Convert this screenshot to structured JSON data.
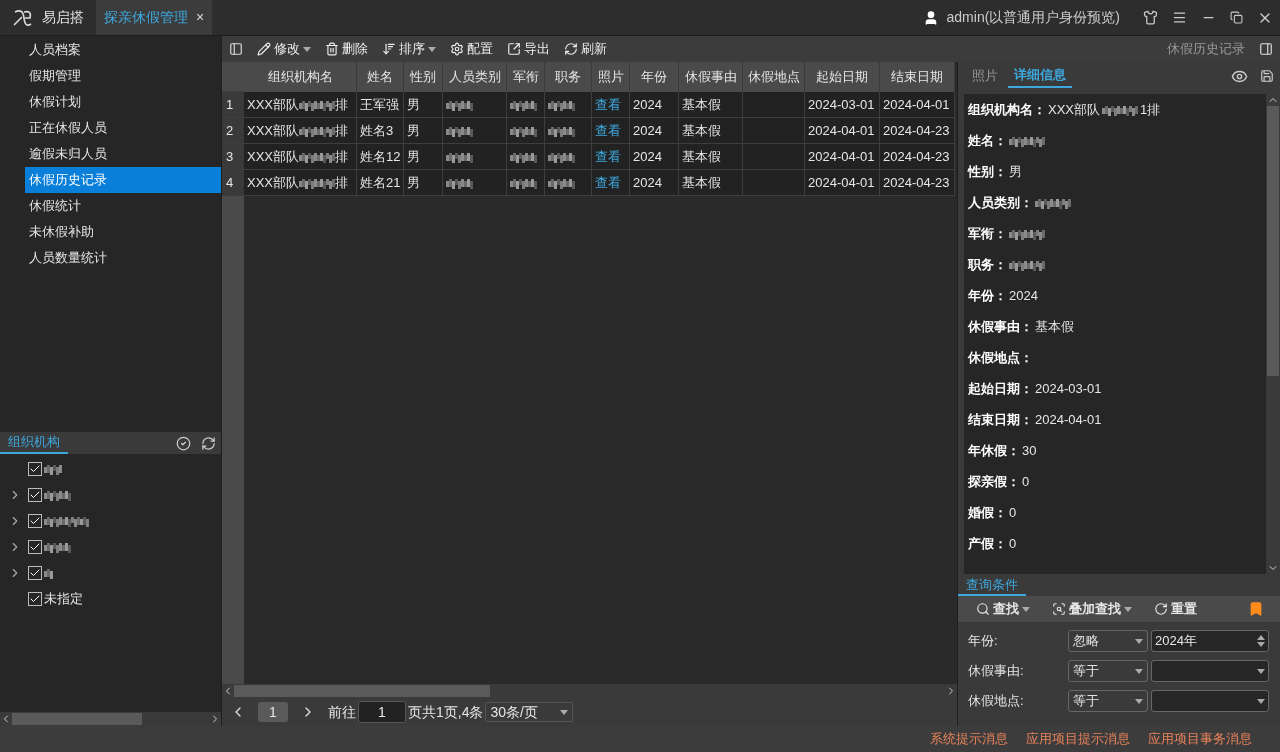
{
  "app": {
    "name": "易启搭"
  },
  "tabs": [
    {
      "label": "探亲休假管理",
      "selected": true,
      "close": "×"
    }
  ],
  "user": {
    "label": "admin(以普通用户身份预览)"
  },
  "nav": [
    {
      "label": "人员档案",
      "selected": false
    },
    {
      "label": "假期管理",
      "selected": false
    },
    {
      "label": "休假计划",
      "selected": false
    },
    {
      "label": "正在休假人员",
      "selected": false
    },
    {
      "label": "逾假未归人员",
      "selected": false
    },
    {
      "label": "休假历史记录",
      "selected": true
    },
    {
      "label": "休假统计",
      "selected": false
    },
    {
      "label": "未休假补助",
      "selected": false
    },
    {
      "label": "人员数量统计",
      "selected": false
    }
  ],
  "org_tree": {
    "title": "组织机构",
    "items": [
      {
        "kind": "leaf",
        "checked": true
      },
      {
        "kind": "branch",
        "checked": true
      },
      {
        "kind": "branch",
        "checked": true
      },
      {
        "kind": "branch",
        "checked": true
      },
      {
        "kind": "branch",
        "checked": true
      },
      {
        "kind": "leaf",
        "checked": true,
        "label": "未指定"
      }
    ]
  },
  "toolbar": [
    {
      "label": "修改",
      "menu": true
    },
    {
      "label": "删除",
      "menu": false
    },
    {
      "label": "排序",
      "menu": true
    },
    {
      "label": "配置",
      "menu": false
    },
    {
      "label": "导出",
      "menu": false
    },
    {
      "label": "刷新",
      "menu": false
    }
  ],
  "breadcrumb": "休假历史记录",
  "table": {
    "columns": [
      "组织机构名",
      "姓名",
      "性别",
      "人员类别",
      "军衔",
      "职务",
      "照片",
      "年份",
      "休假事由",
      "休假地点",
      "起始日期",
      "结束日期"
    ],
    "rows": [
      {
        "number": "1",
        "cells": [
          {
            "kind": "mixed",
            "parts": [
              {
                "text": "XXX部队"
              },
              {
                "kind": "blurred"
              },
              {
                "text": "排"
              }
            ]
          },
          "王军强",
          "男",
          {
            "kind": "blurred"
          },
          {
            "kind": "blurred"
          },
          {
            "kind": "blurred"
          },
          {
            "kind": "link",
            "text": "查看"
          },
          "2024",
          "基本假",
          "",
          "2024-03-01",
          "2024-04-01"
        ]
      },
      {
        "number": "2",
        "cells": [
          {
            "kind": "mixed",
            "parts": [
              {
                "text": "XXX部队"
              },
              {
                "kind": "blurred"
              },
              {
                "text": "排"
              }
            ]
          },
          "姓名3",
          "男",
          {
            "kind": "blurred"
          },
          {
            "kind": "blurred"
          },
          {
            "kind": "blurred"
          },
          {
            "kind": "link",
            "text": "查看"
          },
          "2024",
          "基本假",
          "",
          "2024-04-01",
          "2024-04-23"
        ]
      },
      {
        "number": "3",
        "cells": [
          {
            "kind": "mixed",
            "parts": [
              {
                "text": "XXX部队"
              },
              {
                "kind": "blurred"
              },
              {
                "text": "排"
              }
            ]
          },
          "姓名12",
          "男",
          {
            "kind": "blurred"
          },
          {
            "kind": "blurred"
          },
          {
            "kind": "blurred"
          },
          {
            "kind": "link",
            "text": "查看"
          },
          "2024",
          "基本假",
          "",
          "2024-04-01",
          "2024-04-23"
        ]
      },
      {
        "number": "4",
        "cells": [
          {
            "kind": "mixed",
            "parts": [
              {
                "text": "XXX部队"
              },
              {
                "kind": "blurred"
              },
              {
                "text": "排"
              }
            ]
          },
          "姓名21",
          "男",
          {
            "kind": "blurred"
          },
          {
            "kind": "blurred"
          },
          {
            "kind": "blurred"
          },
          {
            "kind": "link",
            "text": "查看"
          },
          "2024",
          "基本假",
          "",
          "2024-04-01",
          "2024-04-23"
        ]
      }
    ]
  },
  "pagination": {
    "pages": [
      {
        "label": "1",
        "selected": true
      }
    ],
    "goto_label": "前往",
    "goto_value": "1",
    "summary": "页共1页,4条",
    "page_size": "30条/页"
  },
  "detail_tabs": [
    {
      "label": "照片",
      "selected": false
    },
    {
      "label": "详细信息",
      "selected": true
    }
  ],
  "details": [
    {
      "label": "组织机构名：",
      "parts": [
        {
          "text": "XXX部队"
        },
        {
          "kind": "blurred"
        },
        {
          "text": "1排"
        }
      ]
    },
    {
      "label": "姓名：",
      "parts": [
        {
          "kind": "blurred"
        }
      ]
    },
    {
      "label": "性别：",
      "parts": [
        {
          "text": "男"
        }
      ]
    },
    {
      "label": "人员类别：",
      "parts": [
        {
          "kind": "blurred"
        }
      ]
    },
    {
      "label": "军衔：",
      "parts": [
        {
          "kind": "blurred"
        }
      ]
    },
    {
      "label": "职务：",
      "parts": [
        {
          "kind": "blurred"
        }
      ]
    },
    {
      "label": "年份：",
      "parts": [
        {
          "text": "2024"
        }
      ]
    },
    {
      "label": "休假事由：",
      "parts": [
        {
          "text": "基本假"
        }
      ]
    },
    {
      "label": "休假地点："
    },
    {
      "label": "起始日期：",
      "parts": [
        {
          "text": "2024-03-01"
        }
      ]
    },
    {
      "label": "结束日期：",
      "parts": [
        {
          "text": "2024-04-01"
        }
      ]
    },
    {
      "label": "年休假：",
      "parts": [
        {
          "text": "30"
        }
      ]
    },
    {
      "label": "探亲假：",
      "parts": [
        {
          "text": "0"
        }
      ]
    },
    {
      "label": "婚假：",
      "parts": [
        {
          "text": "0"
        }
      ]
    },
    {
      "label": "产假：",
      "parts": [
        {
          "text": "0"
        }
      ]
    }
  ],
  "query": {
    "title": "查询条件",
    "actions": [
      {
        "label": "查找",
        "menu": true
      },
      {
        "label": "叠加查找",
        "menu": true
      },
      {
        "label": "重置",
        "menu": false
      }
    ],
    "fields": [
      {
        "label": "年份:",
        "operator": "忽略",
        "value": "2024年",
        "kind": "spinner"
      },
      {
        "label": "休假事由:",
        "operator": "等于",
        "kind": "dropdown"
      },
      {
        "label": "休假地点:",
        "operator": "等于",
        "kind": "dropdown"
      }
    ]
  },
  "status_bar": [
    "系统提示消息",
    "应用项目提示消息",
    "应用项目事务消息"
  ]
}
